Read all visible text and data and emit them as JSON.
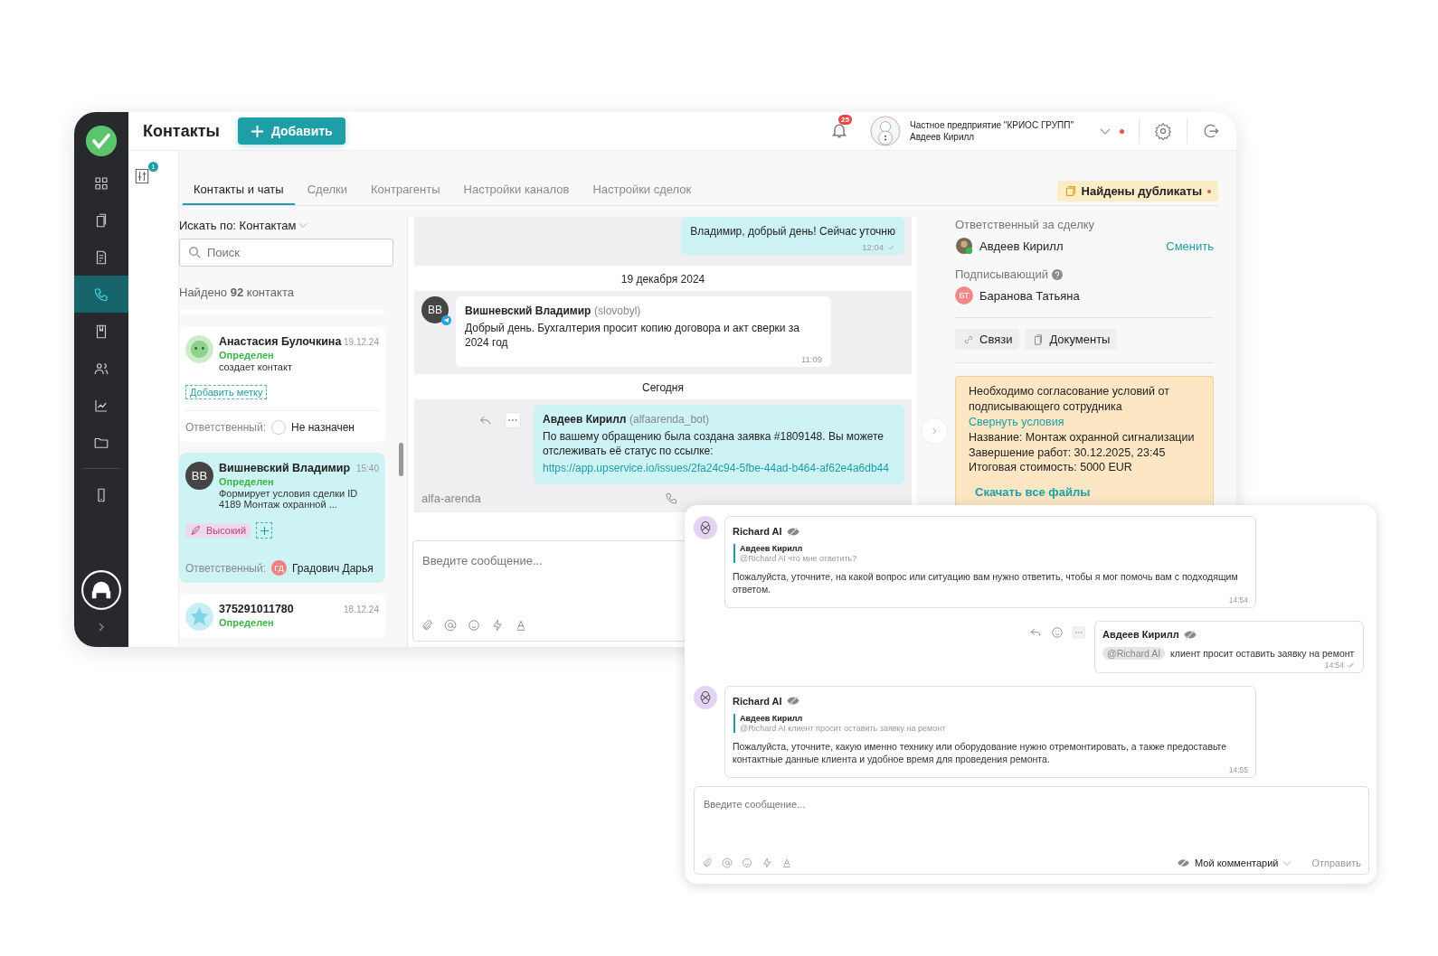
{
  "sidebar": {
    "items": [
      {
        "selected": false
      },
      {
        "selected": false
      },
      {
        "selected": false
      },
      {
        "selected": true
      },
      {
        "selected": false
      },
      {
        "selected": false
      },
      {
        "selected": false
      },
      {
        "selected": false
      },
      {
        "selected": false
      }
    ]
  },
  "header": {
    "title": "Контакты",
    "add_button": "Добавить",
    "notifications": "25",
    "company": "Частное предприятие \"КРИОС ГРУПП\"",
    "user": "Авдеев Кирилл"
  },
  "filter_badge": "1",
  "tabs": [
    {
      "label": "Контакты и чаты",
      "selected": true
    },
    {
      "label": "Сделки",
      "selected": false
    },
    {
      "label": "Контрагенты",
      "selected": false
    },
    {
      "label": "Настройки каналов",
      "selected": false
    },
    {
      "label": "Настройки сделок",
      "selected": false
    }
  ],
  "duplicates": "Найдены дубликаты",
  "contacts": {
    "search_by": "Искать по: Контактам",
    "search_placeholder": "Поиск",
    "found": "Найдено **92** контакта",
    "items": [
      {
        "kind": "smiley",
        "name": "Анастасия Булочкина",
        "date": "19.12.24",
        "status": "Определен",
        "text": "создает контакт",
        "tag_button": "Добавить метку",
        "responsible_label": "Ответственный:",
        "responsible": "Не назначен",
        "selected": false
      },
      {
        "kind": "initials",
        "initials": "ВВ",
        "name": "Вишневский Владимир",
        "date": "15:40",
        "status": "Определен",
        "text": "Формирует условия сделки ID 4189 Монтаж охранной ...",
        "tag": "Высокий",
        "responsible_label": "Ответственный:",
        "responsible_initials": "ГД",
        "responsible": "Градович Дарья",
        "selected": true
      },
      {
        "kind": "flower",
        "name": "375291011780",
        "date": "18.12.24",
        "status": "Определен",
        "selected": false
      }
    ]
  },
  "chat": {
    "messages": [
      {
        "kind": "out",
        "text": "Владимир, добрый день! Сейчас уточню",
        "time": "12:04"
      },
      {
        "kind": "date",
        "text": "19 декабря 2024"
      },
      {
        "kind": "in",
        "initials": "ВВ",
        "author": "Вишневский Владимир",
        "handle": "(slovobyl)",
        "text": "Добрый день. Бухгалтерия просит копию договора и акт сверки за 2024 год",
        "time": "11:09"
      },
      {
        "kind": "date",
        "text": "Сегодня"
      },
      {
        "kind": "out",
        "author": "Авдеев Кирилл",
        "handle": "(alfaarenda_bot)",
        "text": "По вашему обращению была создана заявка #1809148. Вы можете отслеживать её статус по ссылке:",
        "link": "https://app.upservice.io/issues/2fa24c94-5fbe-44ad-b464-af62e4a6db44",
        "channel": "alfa-arenda"
      }
    ],
    "placeholder": "Введите сообщение..."
  },
  "deal": {
    "responsible_label": "Ответственный за сделку",
    "responsible": "Авдеев Кирилл",
    "change": "Сменить",
    "signer_label": "Подписывающий",
    "signer_initials": "БТ",
    "signer": "Баранова Татьяна",
    "buttons": [
      "Связи",
      "Документы"
    ],
    "notice": {
      "text": "Необходимо согласование условий от подписывающего сотрудника",
      "link": "Свернуть условия",
      "lines": [
        "Название: Монтаж охранной сигнализации",
        "Завершение работ: 30.12.2025, 23:45",
        "Итоговая стоимость: 5000 EUR"
      ],
      "download": "Скачать все файлы"
    }
  },
  "popup": {
    "messages": [
      {
        "kind": "ai",
        "author": "Richard AI",
        "quote_author": "Авдеев Кирилл",
        "quote_text": "@Richard AI что мне ответить?",
        "text": "Пожалуйста, уточните, на какой вопрос или ситуацию вам нужно ответить, чтобы я мог помочь вам с подходящим ответом.",
        "time": "14:54"
      },
      {
        "kind": "own",
        "author": "Авдеев Кирилл",
        "mention": "@Richard AI",
        "text": "клиент просит оставить заявку на ремонт",
        "time": "14:54"
      },
      {
        "kind": "ai",
        "author": "Richard AI",
        "quote_author": "Авдеев Кирилл",
        "quote_text": "@Richard AI клиент просит оставить заявку на ремонт",
        "text": "Пожалуйста, уточните, какую именно технику или оборудование нужно отремонтировать, а также предоставьте контактные данные клиента и удобное время для проведения ремонта.",
        "time": "14:55"
      }
    ],
    "placeholder": "Введите сообщение...",
    "mode": "Мой комментарий",
    "send": "Отправить"
  }
}
